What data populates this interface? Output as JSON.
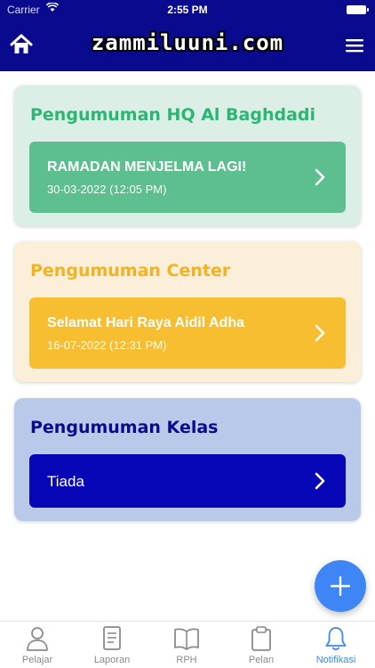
{
  "status_bar": {
    "carrier": "Carrier",
    "time": "2:55 PM"
  },
  "header": {
    "brand": "zammiluuni.com"
  },
  "sections": [
    {
      "title": "Pengumuman HQ Al Baghdadi",
      "item": {
        "title": "RAMADAN MENJELMA LAGI!",
        "date": "30-03-2022 (12:05 PM)"
      },
      "color": "#2bb673"
    },
    {
      "title": "Pengumuman Center",
      "item": {
        "title": "Selamat Hari Raya Aidil Adha",
        "date": "16-07-2022 (12:31 PM)"
      },
      "color": "#f5b21f"
    },
    {
      "title": "Pengumuman Kelas",
      "item": {
        "title": "Tiada"
      },
      "color": "#0a0a8f"
    }
  ],
  "tabs": [
    {
      "label": "Pelajar",
      "icon": "person-icon"
    },
    {
      "label": "Laporan",
      "icon": "document-icon"
    },
    {
      "label": "RPH",
      "icon": "book-icon"
    },
    {
      "label": "Pelan",
      "icon": "clipboard-icon"
    },
    {
      "label": "Notifikasi",
      "icon": "bell-icon",
      "active": true
    }
  ],
  "colors": {
    "header": "#0a0a8f",
    "accent": "#3e86f5"
  }
}
